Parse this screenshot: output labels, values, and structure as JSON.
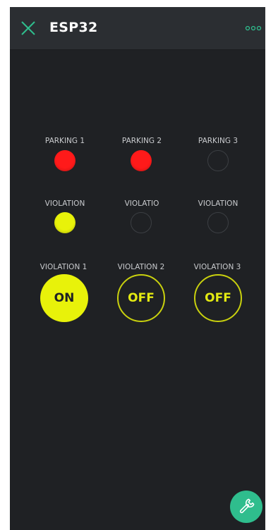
{
  "header": {
    "title": "ESP32",
    "close_icon": "close-icon",
    "more_icon": "more-dots-icon",
    "accent_color": "#2fbd8d"
  },
  "parking_row": [
    {
      "label": "PARKING 1",
      "state": "on",
      "color": "#ff1a1a"
    },
    {
      "label": "PARKING 2",
      "state": "on",
      "color": "#ff1a1a"
    },
    {
      "label": "PARKING 3",
      "state": "off",
      "color": ""
    }
  ],
  "violation_led_row": [
    {
      "label": "VIOLATION",
      "state": "on",
      "color": "#e8f20a"
    },
    {
      "label": "VIOLATIO",
      "state": "off",
      "color": ""
    },
    {
      "label": "VIOLATION",
      "state": "off",
      "color": ""
    }
  ],
  "violation_buttons": [
    {
      "label": "VIOLATION 1",
      "value": "ON",
      "state": "on"
    },
    {
      "label": "VIOLATION 2",
      "value": "OFF",
      "state": "off"
    },
    {
      "label": "VIOLATION 3",
      "value": "OFF",
      "state": "off"
    }
  ],
  "fab": {
    "icon": "wrench-icon",
    "color": "#2fbd8d"
  }
}
